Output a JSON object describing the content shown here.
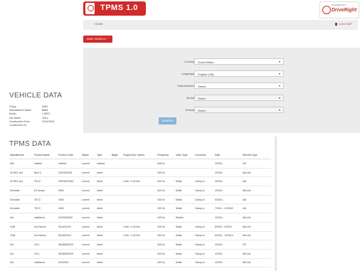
{
  "header": {
    "logo_text": "TPMS 1.0",
    "partner_small": "POWERED BY",
    "partner_name": "DriveRight"
  },
  "nav": {
    "home": "HOME",
    "logout": "LOG OUT"
  },
  "hide_search": "HIDE SEARCH ⌃",
  "search": {
    "rows": [
      {
        "label": "Country",
        "value": "Great Britain",
        "disabled": false
      },
      {
        "label": "Language",
        "value": "English (GB)",
        "disabled": false
      },
      {
        "label": "Manufacturer",
        "value": "Select",
        "disabled": false
      },
      {
        "label": "Model",
        "value": "Select",
        "disabled": true
      },
      {
        "label": "Vehicle",
        "value": "Select",
        "disabled": true
      }
    ],
    "button": "SEARCH"
  },
  "vehicle": {
    "title": "VEHICLE DATA",
    "fields": [
      {
        "k": "KType",
        "v": "5453"
      },
      {
        "k": "Manufacturer Name",
        "v": "BMW"
      },
      {
        "k": "Model",
        "v": "1 (E87)"
      },
      {
        "k": "Car Name",
        "v": "118 d"
      },
      {
        "k": "Construction From",
        "v": "01/11/2002"
      },
      {
        "k": "Construction To",
        "v": ""
      }
    ]
  },
  "tpms": {
    "title": "TPMS DATA",
    "columns": [
      "Manufacturer",
      "Product Name",
      "Product Code",
      "Status",
      "Type",
      "Bagel",
      "Torque (Nut / Valve)",
      "Frequency",
      "Valve Type",
      "Connector",
      "Date",
      "Element Type"
    ],
    "rows": [
      [
        "N/A",
        "Indirect",
        "Indirect",
        "current",
        "Indirect",
        "",
        "",
        "N/A Hz",
        "",
        "",
        "3/2014 -",
        "OE"
      ],
      [
        "SCHR1-omi",
        "Best 3",
        "02R1522002",
        "current",
        "direct",
        "",
        "",
        "433 Hz",
        "",
        "",
        "3/2014 -",
        "AM-Uni"
      ],
      [
        "SCHR1-omi",
        "TECC",
        "02R1522004Z",
        "current",
        "direct",
        "",
        "4 Nm / 0.42 Nm",
        "433 Hz",
        "Metal",
        "Clamp-in",
        "3/2014 -",
        "AM"
      ],
      [
        "Schrader",
        "EZ sensor",
        "3050",
        "current",
        "direct",
        "",
        "",
        "433 Hz",
        "Metal",
        "Clamp-in",
        "3/2014 -",
        "AM-Uni"
      ],
      [
        "Schrader",
        "TECC",
        "4063",
        "current",
        "direct",
        "",
        "",
        "433 Hz",
        "Metal",
        "Clamp-in",
        "6/2014 -",
        "AM"
      ],
      [
        "Schrader",
        "TECC",
        "4063",
        "current",
        "direct",
        "",
        "",
        "433 Hz",
        "Metal",
        "Clamp-in",
        "7/2011 - 12/2018",
        "AM"
      ],
      [
        "Hul",
        "Intellisens",
        "UKS0061052",
        "current",
        "direct",
        "",
        "",
        "433 Hz",
        "Rubber",
        "",
        "4/2014 -",
        "AM-Uni"
      ],
      [
        "OUB",
        "Uni-Sensor",
        "55-6220101",
        "current",
        "direct",
        "",
        "4 Nm / 1.40 Nm",
        "433 Hz",
        "Metal",
        "Clamp-in",
        "8/2010 - 2/2013",
        "AM-Uni"
      ],
      [
        "OUB",
        "Uni-Sensor",
        "55-6220101",
        "current",
        "direct",
        "",
        "4 Nm / 1.40 Nm",
        "433 Hz",
        "Metal",
        "Clamp-in",
        "6/2014 - 12/2014",
        "AM-Uni"
      ],
      [
        "Hul",
        "G3.4",
        "96158406209",
        "current",
        "direct",
        "",
        "",
        "433 Hz",
        "Metal",
        "Clamp-in",
        "3/2014 -",
        "OE"
      ],
      [
        "Hul",
        "G3.4",
        "96158406209",
        "current",
        "direct",
        "",
        "",
        "433 Hz",
        "Metal",
        "Clamp-in",
        "4/2014 -",
        "AM-Uni"
      ],
      [
        "Hul",
        "Intellisens",
        "UKS4010",
        "current",
        "direct",
        "",
        "",
        "433 Hz",
        "Metal",
        "Clamp-in",
        "4/2014 -",
        "AM-Uni"
      ]
    ]
  }
}
